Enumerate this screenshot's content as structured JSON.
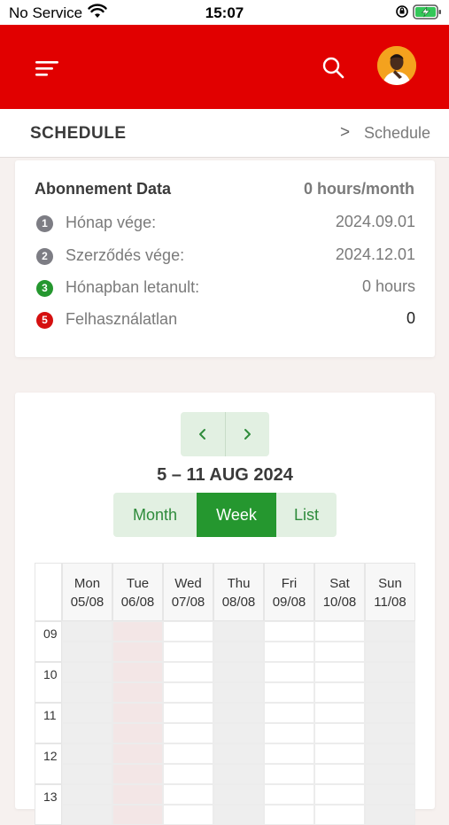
{
  "status_bar": {
    "carrier": "No Service",
    "time": "15:07"
  },
  "header": {
    "menu_icon": "hamburger-menu-icon",
    "search_icon": "search-icon",
    "brand_color": "#e10000"
  },
  "titlebar": {
    "title": "SCHEDULE",
    "breadcrumb_separator": ">",
    "breadcrumb": "Schedule"
  },
  "abonnement": {
    "title": "Abonnement Data",
    "summary": "0 hours/month",
    "rows": [
      {
        "badge": "1",
        "badge_color": "#7d7d84",
        "label": "Hónap vége:",
        "value": "2024.09.01"
      },
      {
        "badge": "2",
        "badge_color": "#7d7d84",
        "label": "Szerződés vége:",
        "value": "2024.12.01"
      },
      {
        "badge": "3",
        "badge_color": "#25972f",
        "label": "Hónapban letanult:",
        "value": "0 hours"
      },
      {
        "badge": "5",
        "badge_color": "#d51010",
        "label": "Felhasználatlan",
        "value": "0"
      }
    ]
  },
  "calendar": {
    "range": "5 – 11 AUG 2024",
    "views": [
      "Month",
      "Week",
      "List"
    ],
    "active_view": "Week",
    "days": [
      {
        "name": "Mon",
        "date": "05/08"
      },
      {
        "name": "Tue",
        "date": "06/08"
      },
      {
        "name": "Wed",
        "date": "07/08"
      },
      {
        "name": "Thu",
        "date": "08/08"
      },
      {
        "name": "Fri",
        "date": "09/08"
      },
      {
        "name": "Sat",
        "date": "10/08"
      },
      {
        "name": "Sun",
        "date": "11/08"
      }
    ],
    "hours": [
      "09",
      "10",
      "11",
      "12",
      "13"
    ],
    "accent_color": "#25972f",
    "today_column_color": "#f3e6e6"
  }
}
